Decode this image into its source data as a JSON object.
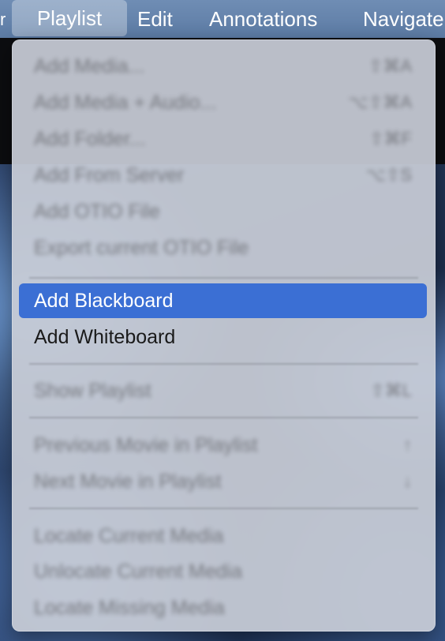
{
  "menubar": {
    "edge_glyph": "r",
    "menus": [
      "Playlist",
      "Edit",
      "Annotations",
      "Navigate"
    ],
    "active": "Playlist"
  },
  "dropdown": {
    "items": [
      {
        "label": "Add Media...",
        "shortcut": "⇧⌘A",
        "enabled": false
      },
      {
        "label": "Add Media + Audio...",
        "shortcut": "⌥⇧⌘A",
        "enabled": false
      },
      {
        "label": "Add Folder...",
        "shortcut": "⇧⌘F",
        "enabled": false
      },
      {
        "label": "Add From Server",
        "shortcut": "⌥⇧S",
        "enabled": false
      },
      {
        "label": "Add OTIO File",
        "shortcut": "",
        "enabled": false
      },
      {
        "label": "Export current OTIO File",
        "shortcut": "",
        "enabled": false
      },
      {
        "label": "Add Blackboard",
        "shortcut": "",
        "enabled": true,
        "highlighted": true
      },
      {
        "label": "Add Whiteboard",
        "shortcut": "",
        "enabled": true
      },
      {
        "label": "Show Playlist",
        "shortcut": "⇧⌘L",
        "enabled": false
      },
      {
        "label": "Previous Movie in Playlist",
        "shortcut": "↑",
        "enabled": false
      },
      {
        "label": "Next Movie in Playlist",
        "shortcut": "↓",
        "enabled": false
      },
      {
        "label": "Locate Current Media",
        "shortcut": "",
        "enabled": false
      },
      {
        "label": "Unlocate Current Media",
        "shortcut": "",
        "enabled": false
      },
      {
        "label": "Locate Missing Media",
        "shortcut": "",
        "enabled": false
      }
    ]
  },
  "colors": {
    "highlight": "#3b6fd4",
    "menubar": "#6585ac",
    "menu_background": "#c8ccd6"
  }
}
